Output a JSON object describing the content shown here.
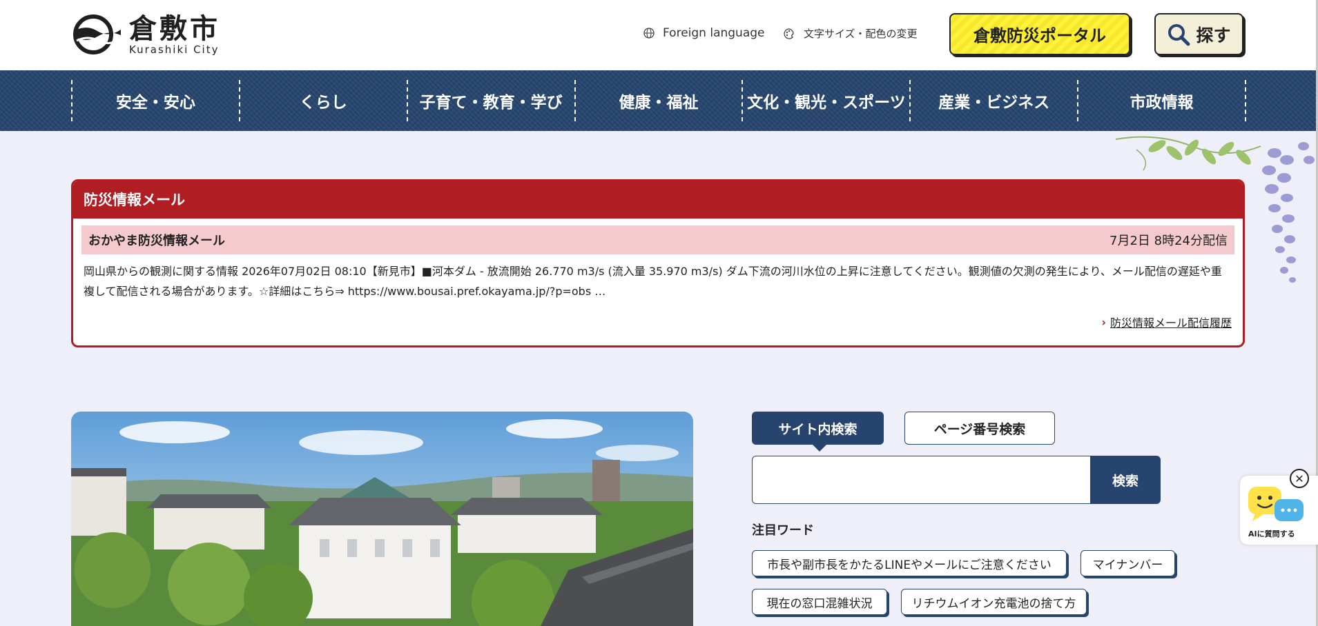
{
  "header": {
    "logo_jp": "倉敷市",
    "logo_en": "Kurashiki City",
    "foreign_language": "Foreign language",
    "text_size": "文字サイズ・配色の変更",
    "portal": "倉敷防災ポータル",
    "search": "探す"
  },
  "nav": {
    "items": [
      "安全・安心",
      "くらし",
      "子育て・教育・学び",
      "健康・福祉",
      "文化・観光・スポーツ",
      "産業・ビジネス",
      "市政情報"
    ]
  },
  "alert": {
    "title": "防災情報メール",
    "subtitle": "おかやま防災情報メール",
    "date": "7月2日 8時24分配信",
    "body": "岡山県からの観測に関する情報 2026年07月02日 08:10【新見市】■河本ダム - 放流開始 26.770 m3/s (流入量 35.970 m3/s) ダム下流の河川水位の上昇に注意してください。観測値の欠測の発生により、メール配信の遅延や重複して配信される場合があります。☆詳細はこちら⇒ https://www.bousai.pref.okayama.jp/?p=obs …",
    "history_link": "防災情報メール配信履歴"
  },
  "search": {
    "tab_site": "サイト内検索",
    "tab_page": "ページ番号検索",
    "input_value": "",
    "submit": "検索",
    "keywords_title": "注目ワード",
    "keywords": [
      "市長や副市長をかたるLINEやメールにご注意ください",
      "マイナンバー",
      "現在の窓口混雑状況",
      "リチウムイオン充電池の捨て方"
    ]
  },
  "ai": {
    "label": "AIに質問する"
  },
  "colors": {
    "navy": "#27446f",
    "alert_red": "#b01e23",
    "alert_pink": "#f5cacf",
    "portal_yellow": "#fff23a",
    "page_bg": "#efeff9"
  }
}
